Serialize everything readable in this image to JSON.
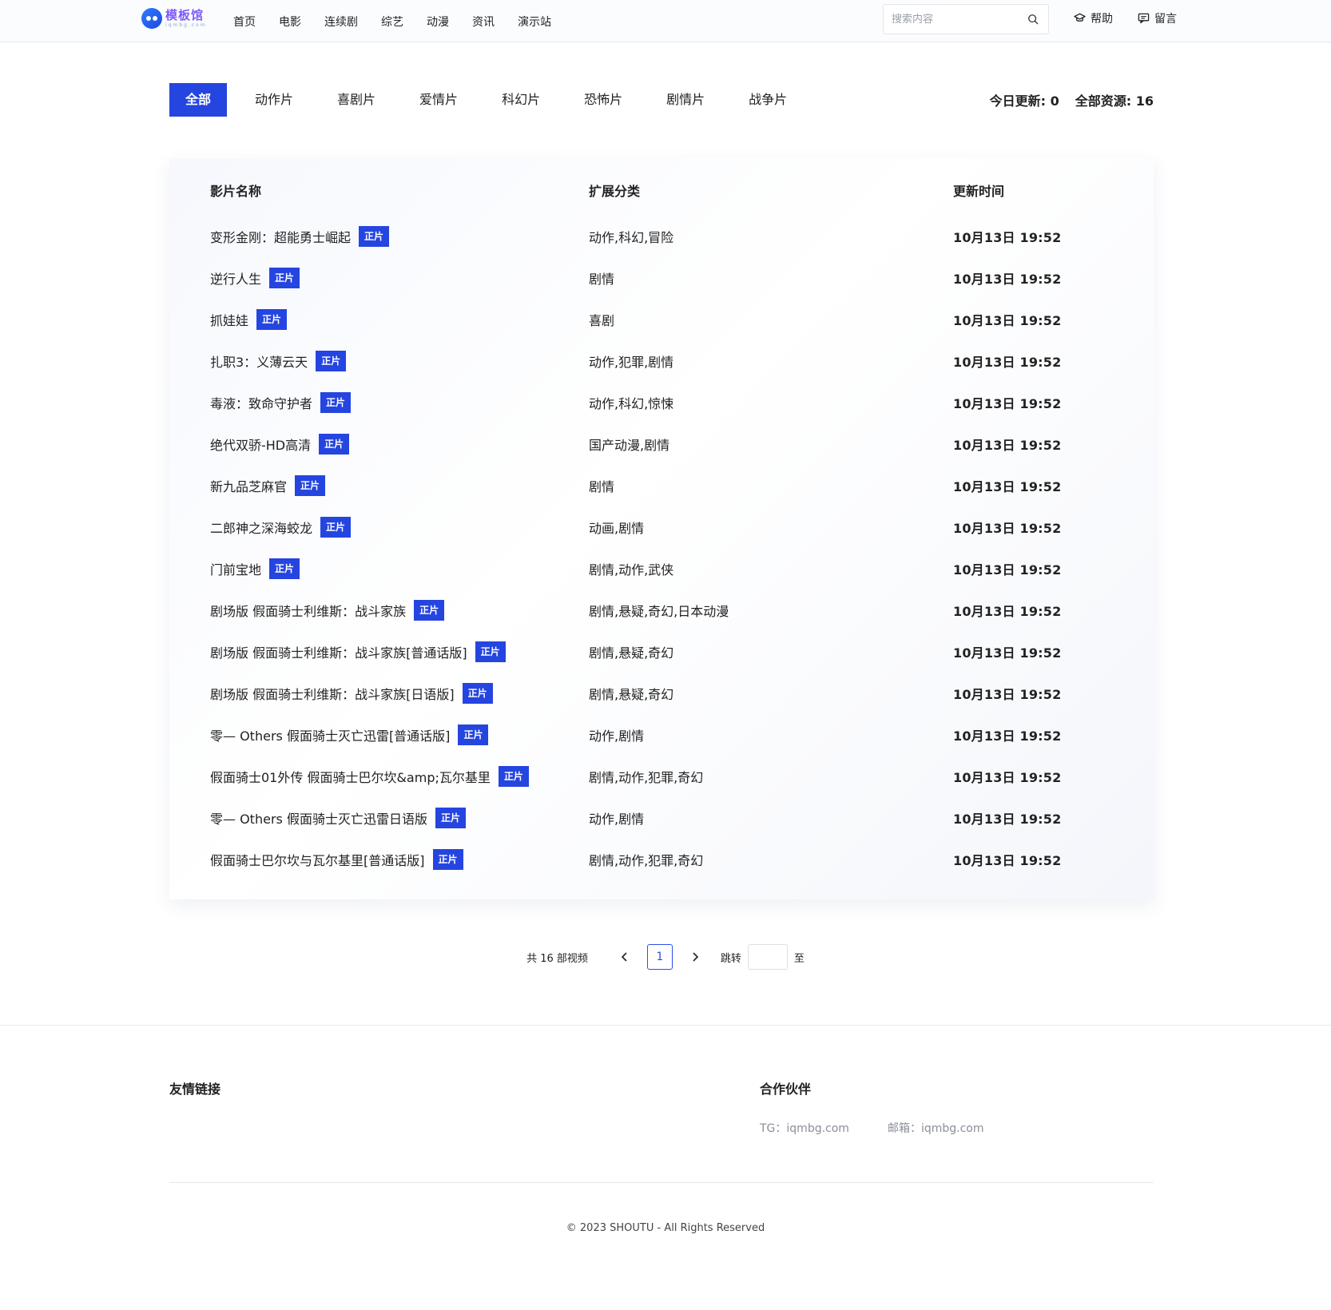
{
  "brand": {
    "name": "模板馆",
    "sub": "iqmbg.com"
  },
  "nav": [
    "首页",
    "电影",
    "连续剧",
    "综艺",
    "动漫",
    "资讯",
    "演示站"
  ],
  "search": {
    "placeholder": "搜索内容"
  },
  "header_links": {
    "help": "帮助",
    "message": "留言"
  },
  "tabs": [
    "全部",
    "动作片",
    "喜剧片",
    "爱情片",
    "科幻片",
    "恐怖片",
    "剧情片",
    "战争片"
  ],
  "stats": {
    "today_label": "今日更新:",
    "today": "0",
    "total_label": "全部资源:",
    "total": "16"
  },
  "table": {
    "headers": [
      "影片名称",
      "扩展分类",
      "更新时间"
    ],
    "badge": "正片",
    "rows": [
      {
        "title": "变形金刚：超能勇士崛起",
        "category": "动作,科幻,冒险",
        "time": "10月13日 19:52"
      },
      {
        "title": "逆行人生",
        "category": "剧情",
        "time": "10月13日 19:52"
      },
      {
        "title": "抓娃娃",
        "category": "喜剧",
        "time": "10月13日 19:52"
      },
      {
        "title": "扎职3：义薄云天",
        "category": "动作,犯罪,剧情",
        "time": "10月13日 19:52"
      },
      {
        "title": "毒液：致命守护者",
        "category": "动作,科幻,惊悚",
        "time": "10月13日 19:52"
      },
      {
        "title": "绝代双骄-HD高清",
        "category": "国产动漫,剧情",
        "time": "10月13日 19:52"
      },
      {
        "title": "新九品芝麻官",
        "category": "剧情",
        "time": "10月13日 19:52"
      },
      {
        "title": "二郎神之深海蛟龙",
        "category": "动画,剧情",
        "time": "10月13日 19:52"
      },
      {
        "title": "门前宝地",
        "category": "剧情,动作,武侠",
        "time": "10月13日 19:52"
      },
      {
        "title": "剧场版 假面骑士利维斯：战斗家族",
        "category": "剧情,悬疑,奇幻,日本动漫",
        "time": "10月13日 19:52"
      },
      {
        "title": "剧场版 假面骑士利维斯：战斗家族[普通话版]",
        "category": "剧情,悬疑,奇幻",
        "time": "10月13日 19:52"
      },
      {
        "title": "剧场版 假面骑士利维斯：战斗家族[日语版]",
        "category": "剧情,悬疑,奇幻",
        "time": "10月13日 19:52"
      },
      {
        "title": "零— Others 假面骑士灭亡迅雷[普通话版]",
        "category": "动作,剧情",
        "time": "10月13日 19:52"
      },
      {
        "title": "假面骑士01外传 假面骑士巴尔坎&amp;瓦尔基里",
        "category": "剧情,动作,犯罪,奇幻",
        "time": "10月13日 19:52"
      },
      {
        "title": "零— Others 假面骑士灭亡迅雷日语版",
        "category": "动作,剧情",
        "time": "10月13日 19:52"
      },
      {
        "title": "假面骑士巴尔坎与瓦尔基里[普通话版]",
        "category": "剧情,动作,犯罪,奇幻",
        "time": "10月13日 19:52"
      }
    ]
  },
  "pagination": {
    "total_text": "共 16 部视频",
    "current_page": "1",
    "jump_label": "跳转",
    "jump_suffix": "至"
  },
  "footer": {
    "friend_links_title": "友情链接",
    "partners_title": "合作伙伴",
    "partner_tg": "TG：iqmbg.com",
    "partner_email": "邮箱：iqmbg.com",
    "copyright": "© 2023 SHOUTU - All Rights Reserved"
  },
  "colors": {
    "accent": "#2545e0",
    "brand": "#7c5cff"
  }
}
